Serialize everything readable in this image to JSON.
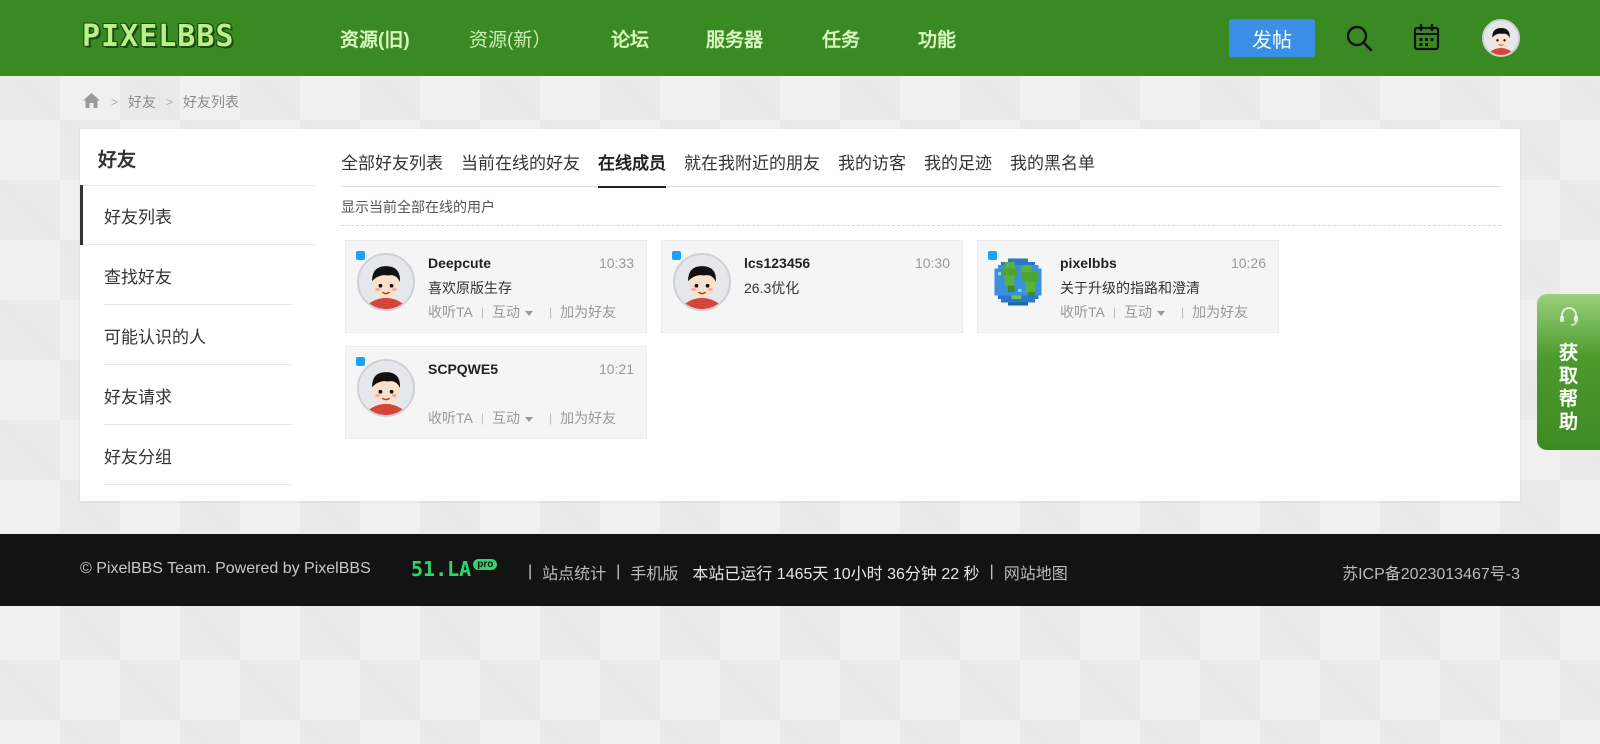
{
  "header": {
    "logo_text": "PIXELBBS",
    "nav": [
      {
        "label": "资源(旧)"
      },
      {
        "label": "资源(新）"
      },
      {
        "label": "论坛"
      },
      {
        "label": "服务器"
      },
      {
        "label": "任务"
      },
      {
        "label": "功能"
      }
    ],
    "post_button": "发帖",
    "icons": [
      "search-icon",
      "calendar-icon",
      "avatar"
    ]
  },
  "breadcrumb": {
    "home_icon": "home-icon",
    "items": [
      "好友",
      "好友列表"
    ]
  },
  "sidebar": {
    "title": "好友",
    "items": [
      {
        "label": "好友列表",
        "active": true
      },
      {
        "label": "查找好友"
      },
      {
        "label": "可能认识的人"
      },
      {
        "label": "好友请求"
      },
      {
        "label": "好友分组"
      }
    ]
  },
  "tabs": [
    {
      "label": "全部好友列表"
    },
    {
      "label": "当前在线的好友"
    },
    {
      "label": "在线成员",
      "active": true
    },
    {
      "label": "就在我附近的朋友"
    },
    {
      "label": "我的访客"
    },
    {
      "label": "我的足迹"
    },
    {
      "label": "我的黑名单"
    }
  ],
  "description": "显示当前全部在线的用户",
  "members": [
    {
      "name": "Deepcute",
      "time": "10:33",
      "signature": "喜欢原版生存",
      "avatar": "cartoon-boy",
      "has_actions": true
    },
    {
      "name": "lcs123456",
      "time": "10:30",
      "signature": "26.3优化",
      "avatar": "cartoon-boy",
      "has_actions": false
    },
    {
      "name": "pixelbbs",
      "time": "10:26",
      "signature": "关于升级的指路和澄清",
      "avatar": "pixel-earth",
      "has_actions": true
    },
    {
      "name": "SCPQWE5",
      "time": "10:21",
      "signature": "",
      "avatar": "cartoon-boy",
      "has_actions": true
    }
  ],
  "member_actions": {
    "follow": "收听TA",
    "interact": "互动",
    "add_friend": "加为好友"
  },
  "help_tab": {
    "text": "获取帮助"
  },
  "footer": {
    "copyright": "© PixelBBS Team. Powered by PixelBBS",
    "badge_main": "51.LA",
    "badge_pro": "pro",
    "stats": "站点统计",
    "mobile": "手机版",
    "uptime": "本站已运行 1465天 10小时 36分钟 22 秒",
    "sitemap": "网站地图",
    "icp": "苏ICP备2023013467号-3"
  },
  "colors": {
    "header_bg": "#3a8a23",
    "post_button": "#3c8fe6",
    "online_dot": "#1aa3ff",
    "footer_bg": "#131313",
    "accent_green": "#2fd56b"
  }
}
